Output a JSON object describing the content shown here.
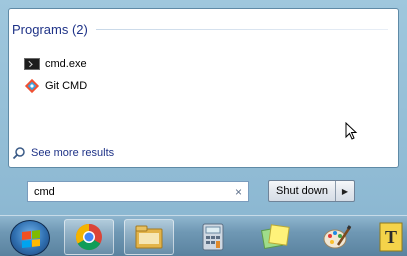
{
  "search_results": {
    "programs_header": "Programs (2)",
    "programs": [
      {
        "label": "cmd.exe",
        "icon": "command-prompt-icon"
      },
      {
        "label": "Git CMD",
        "icon": "git-icon"
      }
    ],
    "see_more_label": "See more results"
  },
  "search": {
    "value": "cmd",
    "clear_icon": "×"
  },
  "shutdown": {
    "label": "Shut down",
    "arrow": "▶"
  },
  "taskbar": {
    "buttons": [
      {
        "name": "start-orb",
        "icon": "windows-flag-icon"
      },
      {
        "name": "chrome",
        "icon": "chrome-icon"
      },
      {
        "name": "file-explorer",
        "icon": "folder-icon"
      },
      {
        "name": "calculator",
        "icon": "calculator-icon"
      },
      {
        "name": "sticky-notes",
        "icon": "sticky-notes-icon"
      },
      {
        "name": "paint",
        "icon": "paint-icon"
      },
      {
        "name": "text-app",
        "icon": "text-document-icon",
        "letter": "T"
      }
    ]
  },
  "colors": {
    "header_text": "#1e3287",
    "menu_bg": "#9fc7dd",
    "taskbar_bg": "#6f98b4"
  }
}
